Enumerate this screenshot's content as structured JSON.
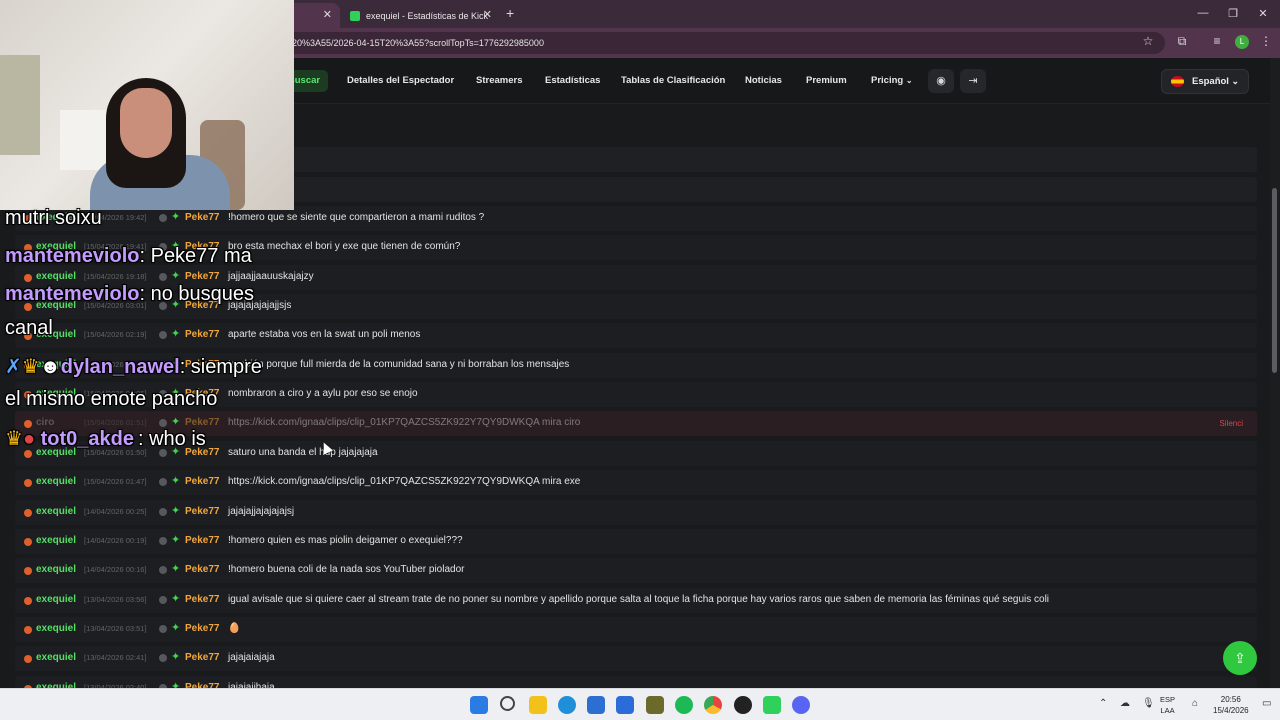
{
  "browser": {
    "tabs": [
      {
        "label": ""
      },
      {
        "label": "exequiel - Estadísticas de Kick"
      }
    ],
    "url": "20%3A55/2026-04-15T20%3A55?scrollTopTs=1776292985000",
    "profile_initial": "L"
  },
  "nav": {
    "search_label": "Buscar",
    "items": [
      "Detalles del Espectador",
      "Streamers",
      "Estadísticas",
      "Tablas de Clasificación",
      "Noticias",
      "Premium",
      "Pricing"
    ],
    "language": "Español"
  },
  "chat_rows": [
    {
      "channel": "exequiel",
      "ts": "[15/04/2026 19:42]",
      "user": "Peke77",
      "msg": "!homero que se siente que compartieron a mami ruditos ?"
    },
    {
      "channel": "exequiel",
      "ts": "[15/04/2026 19:41]",
      "user": "Peke77",
      "msg": "bro esta mechax el bori y exe que tienen de común?"
    },
    {
      "channel": "exequiel",
      "ts": "[15/04/2026 19:18]",
      "user": "Peke77",
      "msg": "jajjaajjaauuskajajzy"
    },
    {
      "channel": "exequiel",
      "ts": "[15/04/2026 03:01]",
      "user": "Peke77",
      "msg": "jajajajajajajjsjs"
    },
    {
      "channel": "exequiel",
      "ts": "[15/04/2026 02:19]",
      "user": "Peke77",
      "msg": "aparte estaba vos en la swat un poli menos"
    },
    {
      "channel": "exequiel",
      "ts": "[15/04/2026 02:12]",
      "user": "Peke77",
      "msg": "también porque full mierda de la comunidad sana y ni borraban los mensajes"
    },
    {
      "channel": "exequiel",
      "ts": "[15/04/2026 02:05]",
      "user": "Peke77",
      "msg": "nombraron a ciro y a aylu por eso se enojo"
    },
    {
      "channel": "ciro",
      "ts": "[15/04/2026 01:51]",
      "user": "Peke77",
      "msg": "https://kick.com/ignaa/clips/clip_01KP7QAZCS5ZK922Y7QY9DWKQA mira ciro",
      "deleted": true,
      "status": "Silenci"
    },
    {
      "channel": "exequiel",
      "ts": "[15/04/2026 01:50]",
      "user": "Peke77",
      "msg": "saturo una banda el hdp jajajajaja"
    },
    {
      "channel": "exequiel",
      "ts": "[15/04/2026 01:47]",
      "user": "Peke77",
      "msg": "https://kick.com/ignaa/clips/clip_01KP7QAZCS5ZK922Y7QY9DWKQA mira exe"
    },
    {
      "channel": "exequiel",
      "ts": "[14/04/2026 00:25]",
      "user": "Peke77",
      "msg": "jajajajjajajajajsj"
    },
    {
      "channel": "exequiel",
      "ts": "[14/04/2026 00:19]",
      "user": "Peke77",
      "msg": "!homero quien es mas piolin deigamer o exequiel???"
    },
    {
      "channel": "exequiel",
      "ts": "[14/04/2026 00:16]",
      "user": "Peke77",
      "msg": "!homero buena coli de la nada sos YouTuber piolador"
    },
    {
      "channel": "exequiel",
      "ts": "[13/04/2026 03:56]",
      "user": "Peke77",
      "msg": "igual avisale que si quiere caer al stream trate de no poner su nombre y apellido porque salta al toque la ficha porque hay varios raros que saben de memoria las féminas qué seguis coli"
    },
    {
      "channel": "exequiel",
      "ts": "[13/04/2026 03:51]",
      "user": "Peke77",
      "msg": "🥚"
    },
    {
      "channel": "exequiel",
      "ts": "[13/04/2026 02:41]",
      "user": "Peke77",
      "msg": "jajajaiajaja"
    },
    {
      "channel": "exequiel",
      "ts": "[13/04/2026 02:40]",
      "user": "Peke77",
      "msg": "jajajajjhaja"
    }
  ],
  "overlay": {
    "l1": "mutri soixu",
    "l2_user": "mantemeviolo",
    "l2_msg": ": Peke77 ma",
    "l3_user": "mantemeviolo",
    "l3_msg": ": no busques",
    "l4": "canal",
    "l5_user": "dylan_nawel",
    "l5_msg": ": siempre",
    "l6": "el mismo emote pancho",
    "l7_user": "tot0_akde",
    "l7_msg": ": who is"
  },
  "taskbar": {
    "lang_top": "ESP",
    "lang_bottom": "LAA",
    "time": "20:56",
    "date": "15/4/2026"
  }
}
